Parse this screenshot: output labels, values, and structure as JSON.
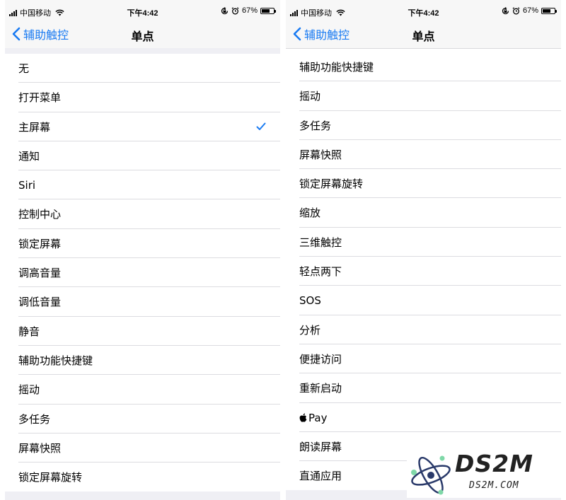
{
  "status_bar": {
    "carrier": "中国移动",
    "time": "下午4:42",
    "battery_percent": "67%",
    "battery_level": 0.67
  },
  "nav": {
    "back_label": "辅助触控",
    "title": "单点"
  },
  "left_list": {
    "selected_index": 2,
    "items": [
      "无",
      "打开菜单",
      "主屏幕",
      "通知",
      "Siri",
      "控制中心",
      "锁定屏幕",
      "调高音量",
      "调低音量",
      "静音",
      "辅助功能快捷键",
      "摇动",
      "多任务",
      "屏幕快照",
      "锁定屏幕旋转"
    ]
  },
  "right_list": {
    "items": [
      "辅助功能快捷键",
      "摇动",
      "多任务",
      "屏幕快照",
      "锁定屏幕旋转",
      "缩放",
      "三维触控",
      "轻点两下",
      "SOS",
      "分析",
      "便捷访问",
      "重新启动",
      "Pay",
      "朗读屏幕",
      "直通应用"
    ],
    "apple_pay_index": 12
  },
  "watermark": {
    "brand": "DS2M",
    "url": "DS2M.COM"
  },
  "colors": {
    "accent": "#1a7bf2",
    "bar_bg": "#f7f7f7",
    "group_bg": "#efeff4",
    "divider": "#dcdce0"
  }
}
